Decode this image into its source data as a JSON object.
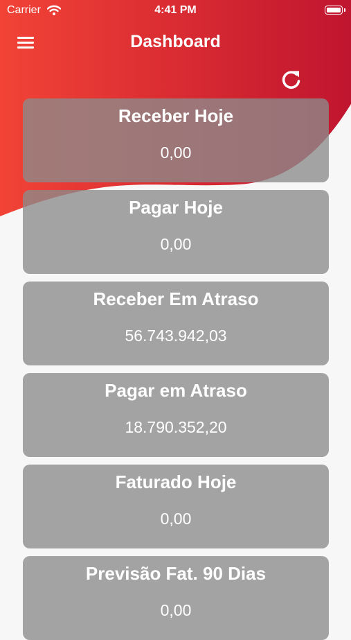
{
  "status_bar": {
    "carrier": "Carrier",
    "time": "4:41 PM"
  },
  "header": {
    "title": "Dashboard"
  },
  "icons": {
    "menu": "hamburger-menu-icon",
    "refresh": "refresh-icon",
    "wifi": "wifi-icon",
    "battery": "battery-icon"
  },
  "colors": {
    "gradient_start": "#f24336",
    "gradient_end": "#c0152f",
    "card": "#8c8c8c",
    "background": "#f7f7f7"
  },
  "cards": [
    {
      "label": "Receber Hoje",
      "value": "0,00"
    },
    {
      "label": "Pagar Hoje",
      "value": "0,00"
    },
    {
      "label": "Receber Em Atraso",
      "value": "56.743.942,03"
    },
    {
      "label": "Pagar em Atraso",
      "value": "18.790.352,20"
    },
    {
      "label": "Faturado Hoje",
      "value": "0,00"
    },
    {
      "label": "Previsão Fat. 90 Dias",
      "value": "0,00"
    }
  ]
}
